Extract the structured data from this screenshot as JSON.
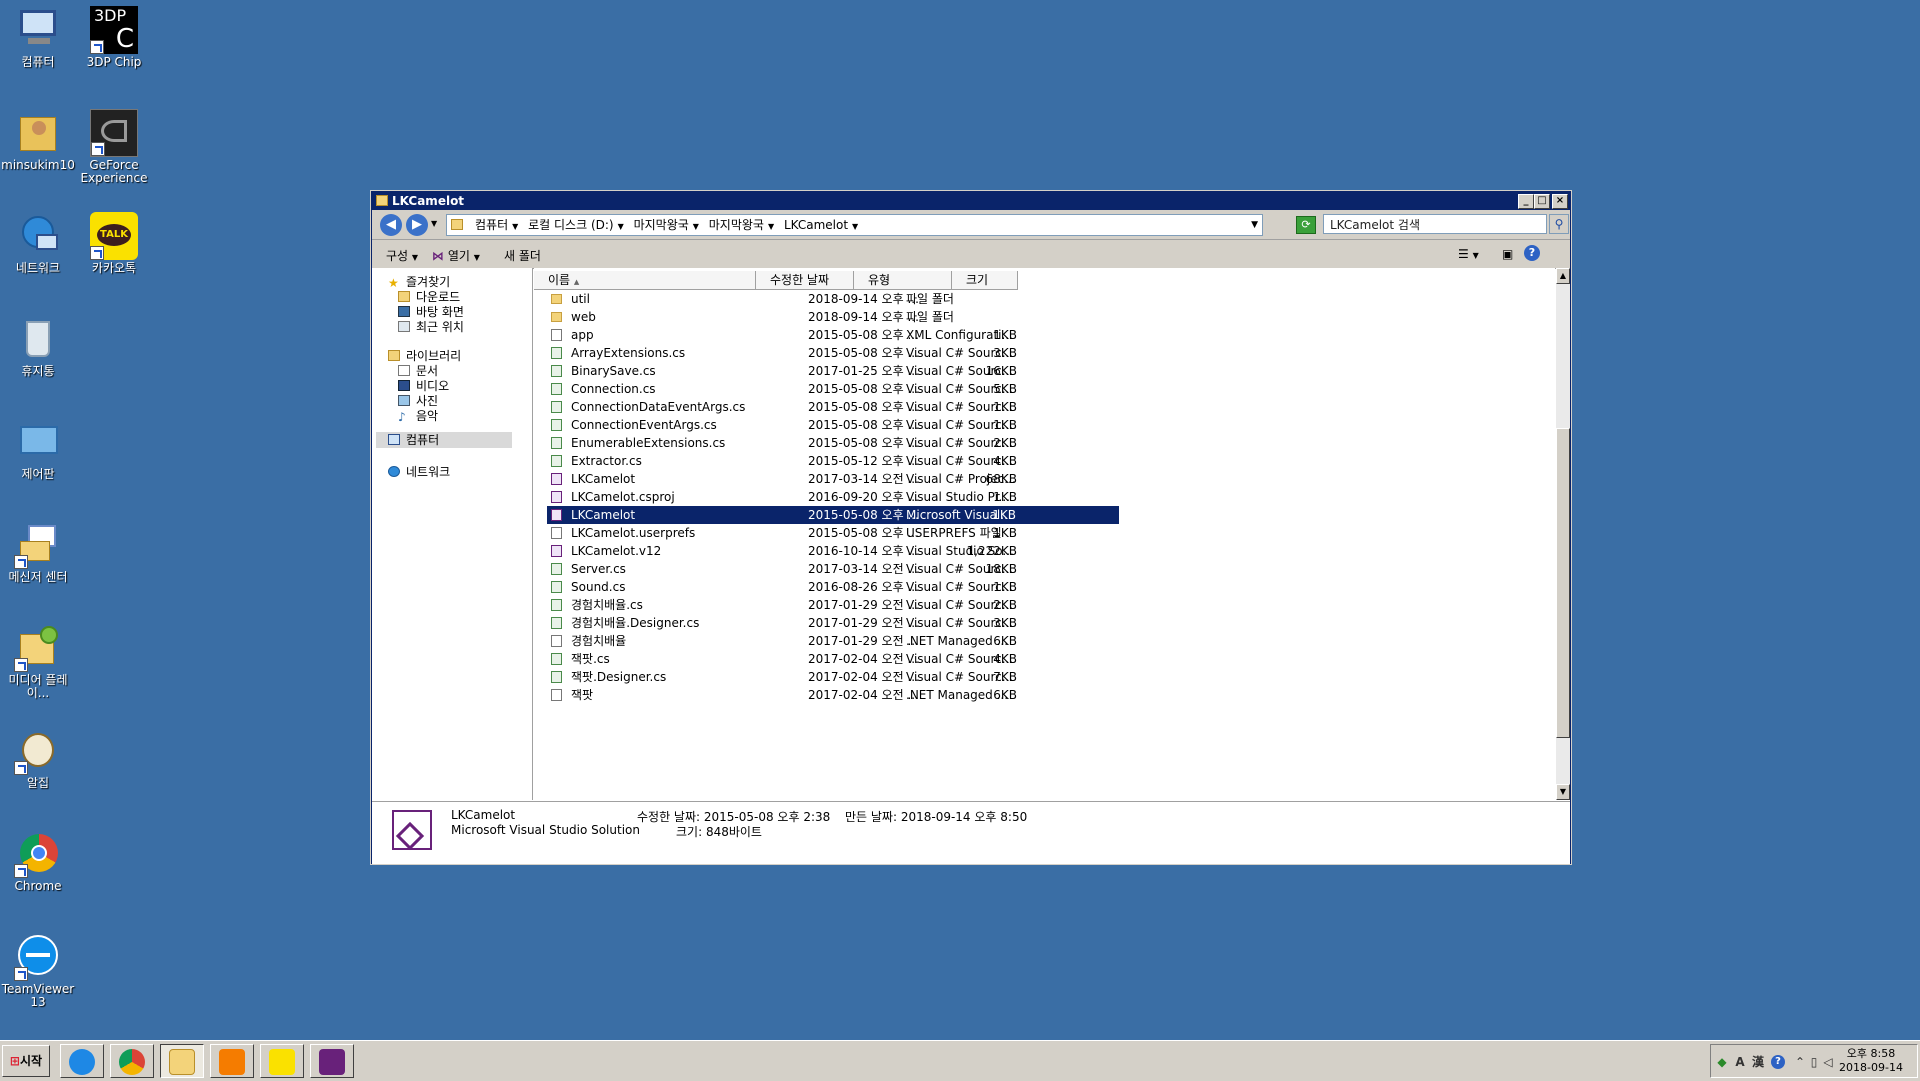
{
  "desktop": {
    "icons": [
      {
        "label": "컴퓨터",
        "icon": "computer-icon"
      },
      {
        "label": "3DP Chip",
        "icon": "3dp-chip-icon"
      },
      {
        "label": "minsukim10",
        "icon": "user-folder-icon"
      },
      {
        "label": "GeForce Experience",
        "icon": "geforce-icon"
      },
      {
        "label": "네트워크",
        "icon": "network-icon"
      },
      {
        "label": "카카오톡",
        "icon": "kakaotalk-icon"
      },
      {
        "label": "휴지통",
        "icon": "recycle-bin-icon"
      },
      {
        "label": "제어판",
        "icon": "control-panel-icon"
      },
      {
        "label": "메신저 센터",
        "icon": "messenger-icon"
      },
      {
        "label": "미디어 플레이...",
        "icon": "media-player-icon"
      },
      {
        "label": "알집",
        "icon": "alzip-icon"
      },
      {
        "label": "Chrome",
        "icon": "chrome-icon"
      },
      {
        "label": "TeamViewer 13",
        "icon": "teamviewer-icon"
      }
    ],
    "chip_text": "3DP",
    "chip_letter": "C",
    "talk_text": "TALK"
  },
  "window": {
    "title": "LKCamelot",
    "minimize": "_",
    "maximize": "□",
    "close": "×",
    "back": "◀",
    "forward": "▶",
    "breadcrumbs": [
      "컴퓨터",
      "로컬 디스크 (D:)",
      "마지막왕국",
      "마지막왕국",
      "LKCamelot"
    ],
    "search_placeholder": "LKCamelot 검색",
    "toolbar": {
      "organize": "구성",
      "open": "열기",
      "new_folder": "새 폴더"
    },
    "nav": {
      "favorites": "즐겨찾기",
      "downloads": "다운로드",
      "desktop": "바탕 화면",
      "recent": "최근 위치",
      "libraries": "라이브러리",
      "documents": "문서",
      "videos": "비디오",
      "pictures": "사진",
      "music": "음악",
      "computer": "컴퓨터",
      "network": "네트워크"
    },
    "columns": {
      "name": "이름",
      "date": "수정한 날짜",
      "type": "유형",
      "size": "크기"
    },
    "files": [
      {
        "name": "util",
        "date": "2018-09-14 오후 ...",
        "type": "파일 폴더",
        "size": "",
        "kind": "folder"
      },
      {
        "name": "web",
        "date": "2018-09-14 오후 ...",
        "type": "파일 폴더",
        "size": "",
        "kind": "folder"
      },
      {
        "name": "app",
        "date": "2015-05-08 오후 ...",
        "type": "XML Configurati...",
        "size": "1KB",
        "kind": "config"
      },
      {
        "name": "ArrayExtensions.cs",
        "date": "2015-05-08 오후 ...",
        "type": "Visual C# Sourc...",
        "size": "3KB",
        "kind": "cs"
      },
      {
        "name": "BinarySave.cs",
        "date": "2017-01-25 오후 ...",
        "type": "Visual C# Sourc...",
        "size": "16KB",
        "kind": "cs"
      },
      {
        "name": "Connection.cs",
        "date": "2015-05-08 오후 ...",
        "type": "Visual C# Sourc...",
        "size": "5KB",
        "kind": "cs"
      },
      {
        "name": "ConnectionDataEventArgs.cs",
        "date": "2015-05-08 오후 ...",
        "type": "Visual C# Sourc...",
        "size": "1KB",
        "kind": "cs"
      },
      {
        "name": "ConnectionEventArgs.cs",
        "date": "2015-05-08 오후 ...",
        "type": "Visual C# Sourc...",
        "size": "1KB",
        "kind": "cs"
      },
      {
        "name": "EnumerableExtensions.cs",
        "date": "2015-05-08 오후 ...",
        "type": "Visual C# Sourc...",
        "size": "2KB",
        "kind": "cs"
      },
      {
        "name": "Extractor.cs",
        "date": "2015-05-12 오후 ...",
        "type": "Visual C# Sourc...",
        "size": "4KB",
        "kind": "cs"
      },
      {
        "name": "LKCamelot",
        "date": "2017-03-14 오전 ...",
        "type": "Visual C# Projec...",
        "size": "68KB",
        "kind": "proj"
      },
      {
        "name": "LKCamelot.csproj",
        "date": "2016-09-20 오후 ...",
        "type": "Visual Studio Pr...",
        "size": "1KB",
        "kind": "vs"
      },
      {
        "name": "LKCamelot",
        "date": "2015-05-08 오후 ...",
        "type": "Microsoft Visual...",
        "size": "1KB",
        "kind": "vs",
        "selected": true
      },
      {
        "name": "LKCamelot.userprefs",
        "date": "2015-05-08 오후 ...",
        "type": "USERPREFS 파일",
        "size": "1KB",
        "kind": "file"
      },
      {
        "name": "LKCamelot.v12",
        "date": "2016-10-14 오후 ...",
        "type": "Visual Studio So...",
        "size": "1,222KB",
        "kind": "vs"
      },
      {
        "name": "Server.cs",
        "date": "2017-03-14 오전 ...",
        "type": "Visual C# Sourc...",
        "size": "18KB",
        "kind": "cs"
      },
      {
        "name": "Sound.cs",
        "date": "2016-08-26 오후 ...",
        "type": "Visual C# Sourc...",
        "size": "1KB",
        "kind": "cs"
      },
      {
        "name": "경험치배율.cs",
        "date": "2017-01-29 오전 ...",
        "type": "Visual C# Sourc...",
        "size": "2KB",
        "kind": "cs"
      },
      {
        "name": "경험치배율.Designer.cs",
        "date": "2017-01-29 오전 ...",
        "type": "Visual C# Sourc...",
        "size": "3KB",
        "kind": "cs"
      },
      {
        "name": "경험치배율",
        "date": "2017-01-29 오전 ...",
        "type": ".NET Managed ...",
        "size": "6KB",
        "kind": "file"
      },
      {
        "name": "잭팟.cs",
        "date": "2017-02-04 오전 ...",
        "type": "Visual C# Sourc...",
        "size": "4KB",
        "kind": "cs"
      },
      {
        "name": "잭팟.Designer.cs",
        "date": "2017-02-04 오전 ...",
        "type": "Visual C# Sourc...",
        "size": "7KB",
        "kind": "cs"
      },
      {
        "name": "잭팟",
        "date": "2017-02-04 오전 ...",
        "type": ".NET Managed ...",
        "size": "6KB",
        "kind": "file"
      }
    ],
    "details": {
      "name": "LKCamelot",
      "type": "Microsoft Visual Studio Solution",
      "modified_label": "수정한 날짜: 2015-05-08 오후 2:38",
      "created_label": "만든 날짜: 2018-09-14 오후 8:50",
      "size_label": "크기: 848바이트"
    }
  },
  "taskbar": {
    "start_label": "시작",
    "apps": [
      {
        "name": "ie-icon",
        "color": "#1e88e5"
      },
      {
        "name": "chrome-icon",
        "color": "#e53935"
      },
      {
        "name": "explorer-icon",
        "color": "#f3d37a"
      },
      {
        "name": "media-player-icon",
        "color": "#f57c00"
      },
      {
        "name": "kakaotalk-icon",
        "color": "#fae100"
      },
      {
        "name": "visual-studio-icon",
        "color": "#68217a"
      }
    ],
    "tray_ime": "A",
    "tray_hanja": "漢",
    "clock_time": "오후 8:58",
    "clock_date": "2018-09-14"
  },
  "colors": {
    "desktop": "#3a6ea5",
    "title_active": "#0a246a",
    "selection": "#0a246a",
    "vs_purple": "#68217a"
  }
}
